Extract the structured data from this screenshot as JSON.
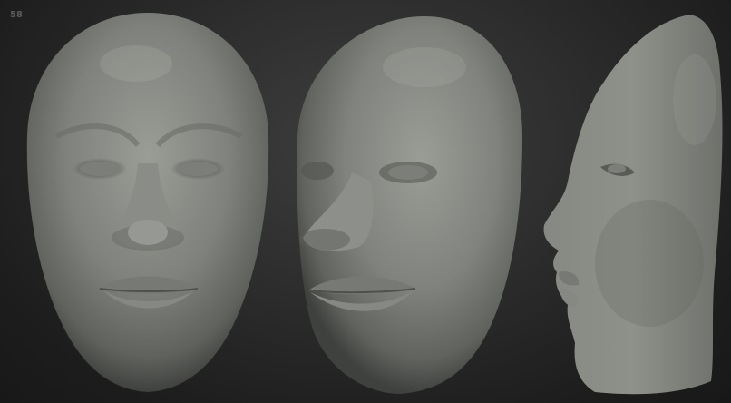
{
  "viewport": {
    "frame_counter": "58",
    "background_color": "#2a2a2a"
  },
  "models": [
    {
      "view": "front",
      "material_color": "#8e918a"
    },
    {
      "view": "three-quarter",
      "material_color": "#8e918a"
    },
    {
      "view": "profile",
      "material_color": "#8e918a"
    }
  ]
}
